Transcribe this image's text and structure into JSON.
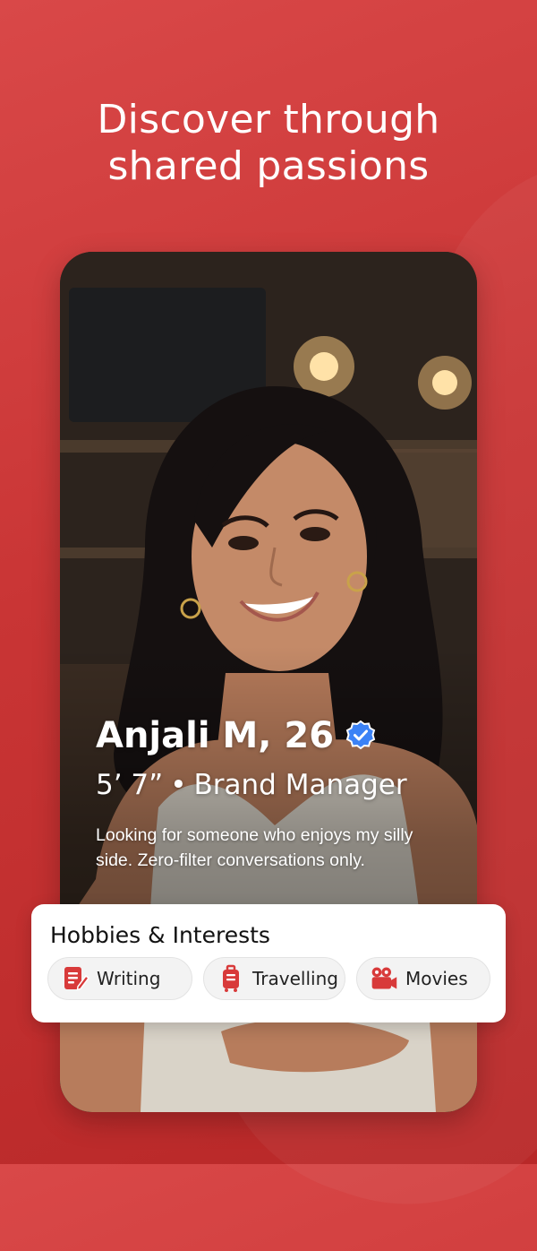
{
  "headline": {
    "line1": "Discover through",
    "line2": "shared passions"
  },
  "profile": {
    "name_age": "Anjali M, 26",
    "verified_icon": "verified-badge-icon",
    "height": "5’ 7”",
    "separator": "•",
    "job": "Brand Manager",
    "bio": "Looking for someone who enjoys my silly side. Zero-filter conversations only."
  },
  "hobbies": {
    "title": "Hobbies & Interests",
    "items": [
      {
        "label": "Writing",
        "icon": "writing-icon"
      },
      {
        "label": "Travelling",
        "icon": "luggage-icon"
      },
      {
        "label": "Movies",
        "icon": "movie-camera-icon"
      }
    ]
  },
  "colors": {
    "background": "#c93535",
    "accent": "#d83a3a",
    "verified": "#3b82f6",
    "card_bg": "#ffffff"
  }
}
